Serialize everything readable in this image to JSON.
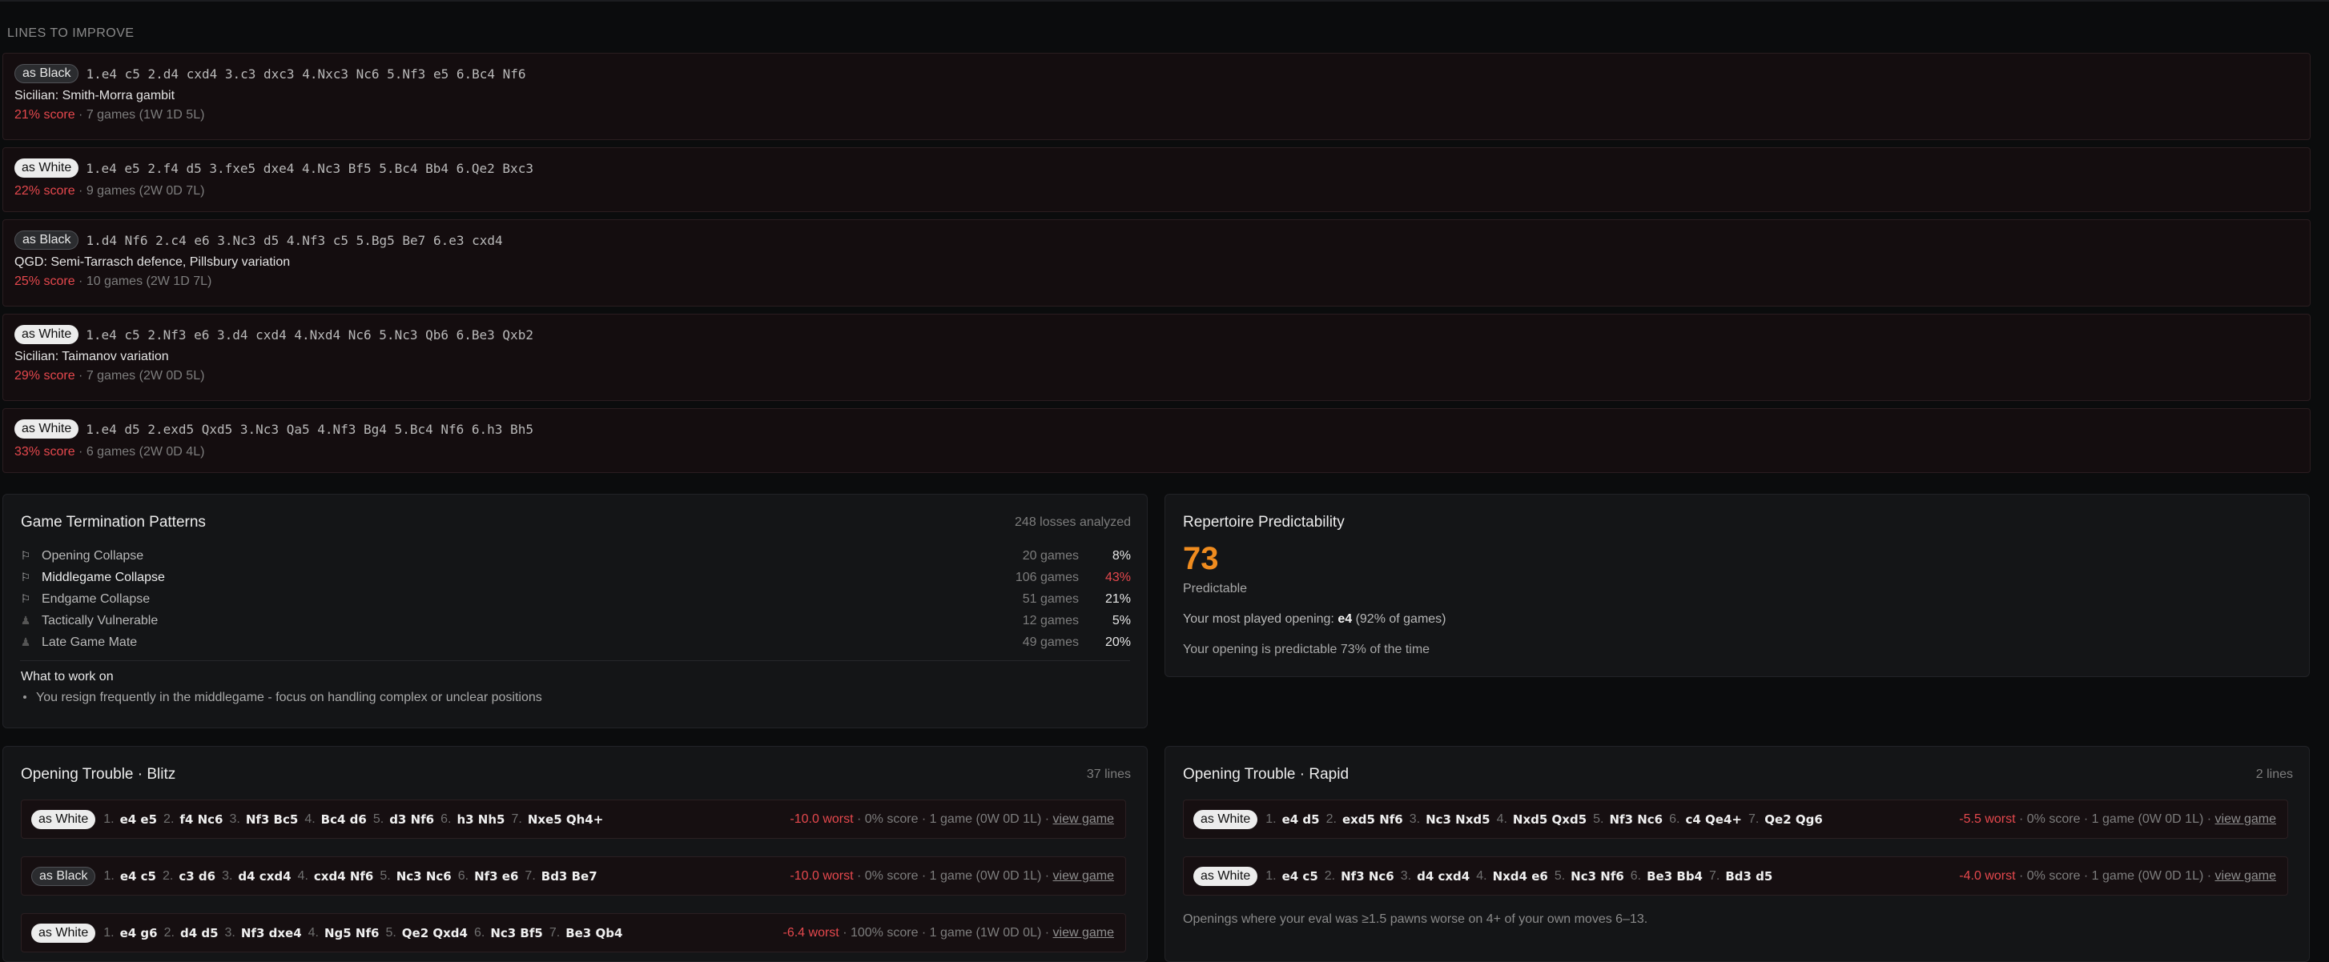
{
  "lines_section": {
    "title": "LINES TO IMPROVE",
    "items": [
      {
        "color": "as Black",
        "moves": "1.e4 c5 2.d4 cxd4 3.c3 dxc3 4.Nxc3 Nc6 5.Nf3 e5 6.Bc4 Nf6",
        "name": "Sicilian: Smith-Morra gambit",
        "score": "21% score",
        "meta": " · 7 games (1W 1D 5L)"
      },
      {
        "color": "as White",
        "moves": "1.e4 e5 2.f4 d5 3.fxe5 dxe4 4.Nc3 Bf5 5.Bc4 Bb4 6.Qe2 Bxc3",
        "name": "",
        "score": "22% score",
        "meta": " · 9 games (2W 0D 7L)"
      },
      {
        "color": "as Black",
        "moves": "1.d4 Nf6 2.c4 e6 3.Nc3 d5 4.Nf3 c5 5.Bg5 Be7 6.e3 cxd4",
        "name": "QGD: Semi-Tarrasch defence, Pillsbury variation",
        "score": "25% score",
        "meta": " · 10 games (2W 1D 7L)"
      },
      {
        "color": "as White",
        "moves": "1.e4 c5 2.Nf3 e6 3.d4 cxd4 4.Nxd4 Nc6 5.Nc3 Qb6 6.Be3 Qxb2",
        "name": "Sicilian: Taimanov variation",
        "score": "29% score",
        "meta": " · 7 games (2W 0D 5L)"
      },
      {
        "color": "as White",
        "moves": "1.e4 d5 2.exd5 Qxd5 3.Nc3 Qa5 4.Nf3 Bg4 5.Bc4 Nf6 6.h3 Bh5",
        "name": "",
        "score": "33% score",
        "meta": " · 6 games (2W 0D 4L)"
      }
    ]
  },
  "termination": {
    "title": "Game Termination Patterns",
    "meta": "248 losses analyzed",
    "rows": [
      {
        "icon": "flag-icon",
        "glyph": "⚐",
        "label": "Opening Collapse",
        "count": "20 games",
        "pct": "8%"
      },
      {
        "icon": "flag-icon",
        "glyph": "⚐",
        "label": "Middlegame Collapse",
        "count": "106 games",
        "pct": "43%"
      },
      {
        "icon": "flag-icon",
        "glyph": "⚐",
        "label": "Endgame Collapse",
        "count": "51 games",
        "pct": "21%"
      },
      {
        "icon": "pawn-icon",
        "glyph": "♟",
        "label": "Tactically Vulnerable",
        "count": "12 games",
        "pct": "5%"
      },
      {
        "icon": "pawn-icon",
        "glyph": "♟",
        "label": "Late Game Mate",
        "count": "49 games",
        "pct": "20%"
      }
    ],
    "work_title": "What to work on",
    "work_item": "You resign frequently in the middlegame - focus on handling complex or unclear positions"
  },
  "predictability": {
    "title": "Repertoire Predictability",
    "number": "73",
    "label": "Predictable",
    "most_played_prefix": "Your most played opening: ",
    "most_played_opening": "e4",
    "most_played_suffix": " (92% of games)",
    "summary": "Your opening is predictable 73% of the time"
  },
  "blitz": {
    "title": "Opening Trouble · Blitz",
    "meta": "37 lines",
    "rows": [
      {
        "color": "as White",
        "moves": [
          [
            "1.",
            "e4 e5"
          ],
          [
            "2.",
            "f4 Nc6"
          ],
          [
            "3.",
            "Nf3 Bc5"
          ],
          [
            "4.",
            "Bc4 d6"
          ],
          [
            "5.",
            "d3 Nf6"
          ],
          [
            "6.",
            "h3 Nh5"
          ],
          [
            "7.",
            "Nxe5 Qh4+"
          ]
        ],
        "worst": "-10.0 worst",
        "rest": " · 0% score · 1 game (0W 0D 1L) · ",
        "link": "view game"
      },
      {
        "color": "as Black",
        "moves": [
          [
            "1.",
            "e4 c5"
          ],
          [
            "2.",
            "c3 d6"
          ],
          [
            "3.",
            "d4 cxd4"
          ],
          [
            "4.",
            "cxd4 Nf6"
          ],
          [
            "5.",
            "Nc3 Nc6"
          ],
          [
            "6.",
            "Nf3 e6"
          ],
          [
            "7.",
            "Bd3 Be7"
          ]
        ],
        "worst": "-10.0 worst",
        "rest": " · 0% score · 1 game (0W 0D 1L) · ",
        "link": "view game"
      },
      {
        "color": "as White",
        "moves": [
          [
            "1.",
            "e4 g6"
          ],
          [
            "2.",
            "d4 d5"
          ],
          [
            "3.",
            "Nf3 dxe4"
          ],
          [
            "4.",
            "Ng5 Nf6"
          ],
          [
            "5.",
            "Qe2 Qxd4"
          ],
          [
            "6.",
            "Nc3 Bf5"
          ],
          [
            "7.",
            "Be3 Qb4"
          ]
        ],
        "worst": "-6.4 worst",
        "rest": " · 100% score · 1 game (1W 0D 0L) · ",
        "link": "view game"
      }
    ]
  },
  "rapid": {
    "title": "Opening Trouble · Rapid",
    "meta": "2 lines",
    "rows": [
      {
        "color": "as White",
        "moves": [
          [
            "1.",
            "e4 d5"
          ],
          [
            "2.",
            "exd5 Nf6"
          ],
          [
            "3.",
            "Nc3 Nxd5"
          ],
          [
            "4.",
            "Nxd5 Qxd5"
          ],
          [
            "5.",
            "Nf3 Nc6"
          ],
          [
            "6.",
            "c4 Qe4+"
          ],
          [
            "7.",
            "Qe2 Qg6"
          ]
        ],
        "worst": "-5.5 worst",
        "rest": " · 0% score · 1 game (0W 0D 1L) · ",
        "link": "view game"
      },
      {
        "color": "as White",
        "moves": [
          [
            "1.",
            "e4 c5"
          ],
          [
            "2.",
            "Nf3 Nc6"
          ],
          [
            "3.",
            "d4 cxd4"
          ],
          [
            "4.",
            "Nxd4 e6"
          ],
          [
            "5.",
            "Nc3 Nf6"
          ],
          [
            "6.",
            "Be3 Bb4"
          ],
          [
            "7.",
            "Bd3 d5"
          ]
        ],
        "worst": "-4.0 worst",
        "rest": " · 0% score · 1 game (0W 0D 1L) · ",
        "link": "view game"
      }
    ],
    "footnote": "Openings where your eval was ≥1.5 pawns worse on 4+ of your own moves 6–13."
  }
}
